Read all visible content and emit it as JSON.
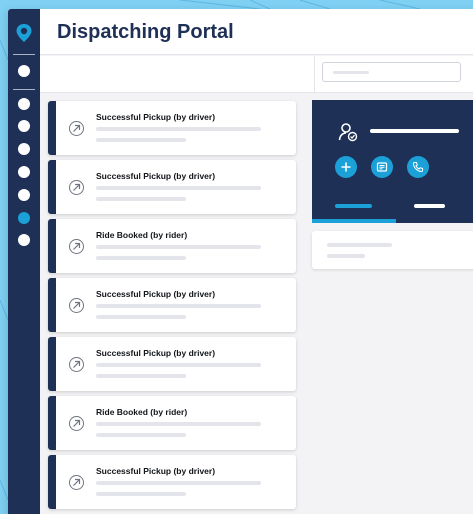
{
  "app": {
    "title": "Dispatching Portal"
  },
  "colors": {
    "navy": "#1f3057",
    "accent": "#1ba0d8",
    "background": "#7fd0f3"
  },
  "sidebar": {
    "logo_icon": "location-pin-logo",
    "items": [
      {
        "icon": "nav-dot",
        "active": false
      },
      {
        "icon": "nav-dot",
        "active": false
      },
      {
        "icon": "nav-dot",
        "active": false
      },
      {
        "icon": "nav-dot",
        "active": false
      },
      {
        "icon": "nav-dot",
        "active": false
      },
      {
        "icon": "nav-dot",
        "active": false
      },
      {
        "icon": "nav-dot",
        "active": true
      },
      {
        "icon": "nav-dot",
        "active": false
      }
    ]
  },
  "search": {
    "placeholder": ""
  },
  "events": [
    {
      "title": "Successful Pickup (by driver)",
      "icon": "arrow-up-right-circle-icon"
    },
    {
      "title": "Successful Pickup (by driver)",
      "icon": "arrow-up-right-circle-icon"
    },
    {
      "title": "Ride Booked (by rider)",
      "icon": "arrow-up-right-circle-icon"
    },
    {
      "title": "Successful Pickup (by driver)",
      "icon": "arrow-up-right-circle-icon"
    },
    {
      "title": "Successful Pickup (by driver)",
      "icon": "arrow-up-right-circle-icon"
    },
    {
      "title": "Ride Booked (by rider)",
      "icon": "arrow-up-right-circle-icon"
    },
    {
      "title": "Successful Pickup (by driver)",
      "icon": "arrow-up-right-circle-icon"
    }
  ],
  "detail_panel": {
    "person_icon": "user-check-icon",
    "actions": [
      {
        "icon": "plus-icon"
      },
      {
        "icon": "document-icon"
      },
      {
        "icon": "phone-icon"
      }
    ],
    "tabs": [
      {
        "active": true
      },
      {
        "active": false
      }
    ]
  }
}
